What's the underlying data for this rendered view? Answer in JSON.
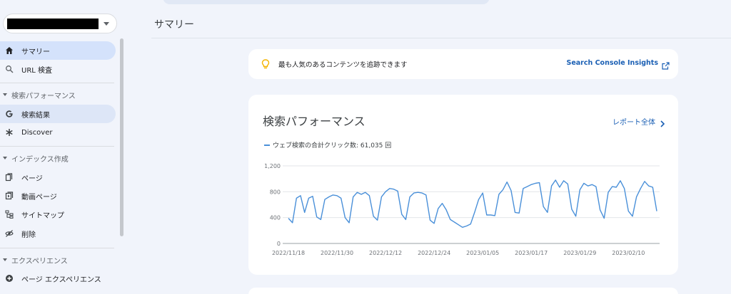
{
  "sidebar": {
    "property_selector": {
      "value": ""
    },
    "items": [
      {
        "label": "サマリー",
        "icon": "home-icon"
      },
      {
        "label": "URL 検査",
        "icon": "search-icon"
      }
    ],
    "sections": [
      {
        "label": "検索パフォーマンス",
        "items": [
          {
            "label": "検索結果",
            "icon": "google-g-icon"
          },
          {
            "label": "Discover",
            "icon": "asterisk-icon"
          }
        ]
      },
      {
        "label": "インデックス作成",
        "items": [
          {
            "label": "ページ",
            "icon": "pages-icon"
          },
          {
            "label": "動画ページ",
            "icon": "video-page-icon"
          },
          {
            "label": "サイトマップ",
            "icon": "sitemap-icon"
          },
          {
            "label": "削除",
            "icon": "removal-icon"
          }
        ]
      },
      {
        "label": "エクスペリエンス",
        "items": [
          {
            "label": "ページ エクスペリエンス",
            "icon": "plus-circle-icon"
          }
        ]
      }
    ]
  },
  "page": {
    "title": "サマリー"
  },
  "insights": {
    "text": "最も人気のあるコンテンツを追跡できます",
    "link": "Search Console Insights",
    "accent": "#f4b400"
  },
  "performance": {
    "title": "検索パフォーマンス",
    "report_link": "レポート全体",
    "legend": "ウェブ検索の合計クリック数: 61,035 回",
    "line_color": "#4a90d9"
  },
  "chart_data": {
    "type": "line",
    "title": "",
    "xlabel": "",
    "ylabel": "",
    "ylim": [
      0,
      1200
    ],
    "y_ticks": [
      "0",
      "400",
      "800",
      "1,200"
    ],
    "x_tick_labels": [
      "2022/11/18",
      "2022/11/30",
      "2022/12/12",
      "2022/12/24",
      "2023/01/05",
      "2023/01/17",
      "2023/01/29",
      "2023/02/10"
    ],
    "series": [
      {
        "name": "ウェブ検索の合計クリック数",
        "values": [
          390,
          320,
          700,
          740,
          480,
          700,
          730,
          410,
          370,
          680,
          720,
          750,
          740,
          700,
          400,
          320,
          720,
          790,
          760,
          790,
          740,
          420,
          360,
          720,
          800,
          850,
          840,
          810,
          450,
          370,
          720,
          780,
          790,
          780,
          750,
          360,
          310,
          540,
          620,
          520,
          370,
          330,
          290,
          250,
          270,
          300,
          480,
          680,
          780,
          440,
          440,
          430,
          760,
          830,
          950,
          820,
          480,
          470,
          850,
          880,
          910,
          930,
          940,
          570,
          480,
          890,
          980,
          870,
          970,
          920,
          530,
          420,
          830,
          930,
          890,
          910,
          880,
          520,
          390,
          790,
          880,
          870,
          970,
          850,
          500,
          420,
          720,
          850,
          960,
          890,
          870,
          500
        ]
      }
    ]
  }
}
